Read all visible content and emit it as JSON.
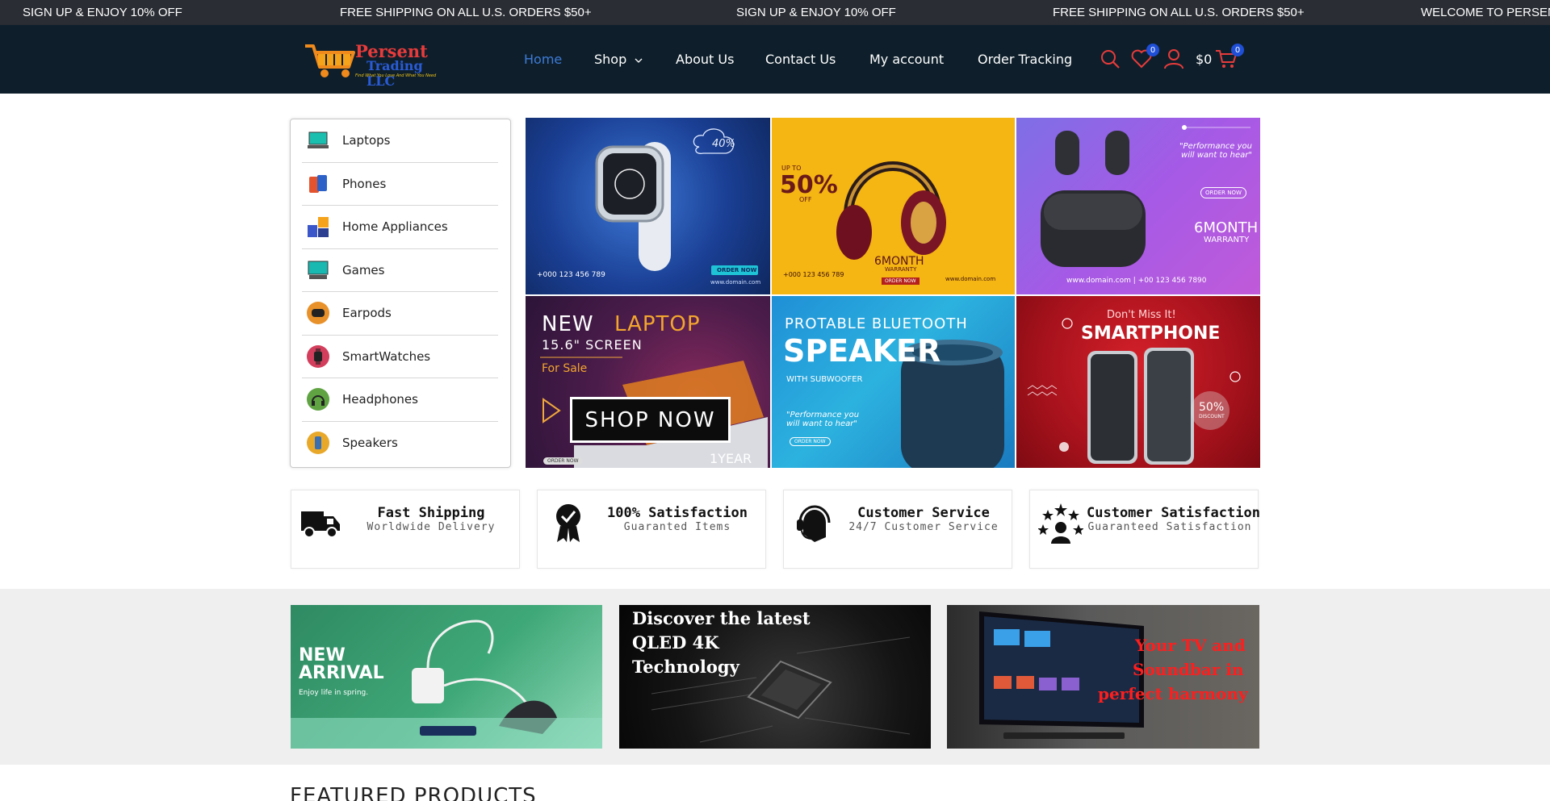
{
  "announcements": [
    "SIGN UP & ENJOY 10% OFF",
    "FREE SHIPPING ON ALL U.S. ORDERS $50+",
    "SIGN UP & ENJOY 10% OFF",
    "FREE SHIPPING ON ALL U.S. ORDERS $50+",
    "WELCOME TO PERSENT T"
  ],
  "brand": {
    "name_line1": "Persent",
    "name_line2": "Trading LLC",
    "tagline": "Find What You Love And What You Need"
  },
  "nav": {
    "items": [
      "Home",
      "Shop",
      "About Us",
      "Contact Us",
      "My account",
      "Order Tracking"
    ],
    "active": "Home"
  },
  "header_icons": {
    "search": "search-icon",
    "wishlist": "heart-icon",
    "account": "user-icon",
    "cart": "cart-icon",
    "wishlist_count": "0",
    "cart_amount": "$0",
    "cart_count": "0"
  },
  "categories": [
    {
      "label": "Laptops",
      "icon": "laptop-icon",
      "color": "#1bbfb0"
    },
    {
      "label": "Phones",
      "icon": "phone-icon",
      "color": "#e2532e"
    },
    {
      "label": "Home Appliances",
      "icon": "appliance-icon",
      "color": "#3a56c9"
    },
    {
      "label": "Games",
      "icon": "gamepad-icon",
      "color": "#19b8b1"
    },
    {
      "label": "Earpods",
      "icon": "earpods-icon",
      "color": "#e8912a"
    },
    {
      "label": "SmartWatches",
      "icon": "smartwatch-icon",
      "color": "#d23e5b"
    },
    {
      "label": "Headphones",
      "icon": "headphones-icon",
      "color": "#5fa343"
    },
    {
      "label": "Speakers",
      "icon": "speaker-icon",
      "color": "#e8a82a"
    }
  ],
  "banners": {
    "watch": {
      "discount": "40%",
      "order": "ORDER NOW",
      "phone": "+000 123 456 789",
      "site": "www.domain.com"
    },
    "headphones": {
      "upto": "UP TO",
      "percent": "50%",
      "off": "OFF",
      "month": "6MONTH",
      "warranty": "WARRANTY",
      "order": "ORDER NOW",
      "phone": "+000 123 456 789",
      "site": "www.domain.com"
    },
    "earpods": {
      "quote": "\"Performance you will want to hear\"",
      "order": "ORDER NOW",
      "month": "6MONTH",
      "warranty": "WARRANTY",
      "contact": "www.domain.com  |  +00 123 456 7890"
    },
    "laptop": {
      "line1a": "NEW",
      "line1b": "LAPTOP",
      "line2": "15.6\" SCREEN",
      "line3": "For Sale",
      "year": "1YEAR",
      "order": "ORDER NOW"
    },
    "speaker": {
      "line1": "PROTABLE BLUETOOTH",
      "line2": "SPEAKER",
      "line3": "WITH SUBWOOFER",
      "quote": "\"Performance you will want to hear\"",
      "order": "ORDER NOW"
    },
    "smartphone": {
      "line1": "Don't Miss It!",
      "line2": "SMARTPHONE",
      "badge": "50%",
      "badge_sub": "DISCOUNT"
    }
  },
  "shop_now": "SHOP NOW",
  "features": [
    {
      "title": "Fast Shipping",
      "subtitle": "Worldwide Delivery",
      "icon": "truck-icon"
    },
    {
      "title": "100% Satisfaction",
      "subtitle": "Guaranted Items",
      "icon": "badge-icon"
    },
    {
      "title": "Customer Service",
      "subtitle": "24/7 Customer Service",
      "icon": "headset-icon"
    },
    {
      "title": "Customer Satisfaction",
      "subtitle": "Guaranteed Satisfaction",
      "icon": "stars-user-icon"
    }
  ],
  "promos": {
    "arrival": {
      "line1": "NEW",
      "line2": "ARRIVAL",
      "line3": "Enjoy life in spring."
    },
    "qled": {
      "line1": "Discover the latest",
      "line2": "QLED 4K",
      "line3": "Technology"
    },
    "tv": {
      "line1": "Your TV and",
      "line2": "Soundbar in",
      "line3": "perfect harmony"
    }
  },
  "featured_title": "FEATURED PRODUCTS",
  "colors": {
    "topbar": "#2a2d33",
    "header": "#0e1f2b",
    "active_nav": "#3d7bd9",
    "accent_red": "#e83b3b",
    "badge": "#1f4fd6"
  }
}
